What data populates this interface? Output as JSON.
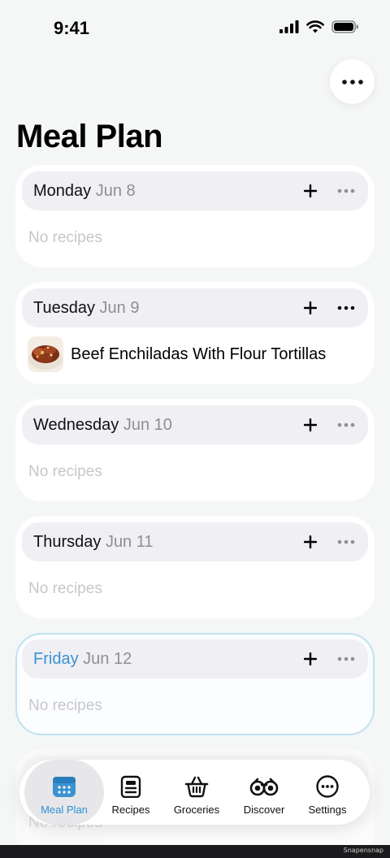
{
  "status_bar": {
    "time": "9:41"
  },
  "header": {
    "title": "Meal Plan",
    "more_icon": "ellipsis-icon"
  },
  "days": [
    {
      "name": "Monday",
      "date": "Jun 8",
      "empty_text": "No recipes"
    },
    {
      "name": "Tuesday",
      "date": "Jun 9",
      "recipe": "Beef Enchiladas With Flour Tortillas"
    },
    {
      "name": "Wednesday",
      "date": "Jun 10",
      "empty_text": "No recipes"
    },
    {
      "name": "Thursday",
      "date": "Jun 11",
      "empty_text": "No recipes"
    },
    {
      "name": "Friday",
      "date": "Jun 12",
      "empty_text": "No recipes"
    },
    {
      "empty_text": "No recipes"
    }
  ],
  "tab_bar": {
    "tabs": [
      {
        "label": "Meal Plan",
        "icon": "calendar-icon",
        "active": true
      },
      {
        "label": "Recipes",
        "icon": "recipe-card-icon"
      },
      {
        "label": "Groceries",
        "icon": "basket-icon"
      },
      {
        "label": "Discover",
        "icon": "binoculars-icon"
      },
      {
        "label": "Settings",
        "icon": "ellipsis-circle-icon"
      }
    ]
  },
  "colors": {
    "accent": "#3a93d0",
    "background": "#f5f6f6",
    "card": "#ffffff",
    "header_pill": "#efeff4",
    "muted_text": "#8e8e93",
    "placeholder_text": "#c7c7cc",
    "today_border": "#bfe1f3"
  },
  "watermark": "Snapensnap"
}
